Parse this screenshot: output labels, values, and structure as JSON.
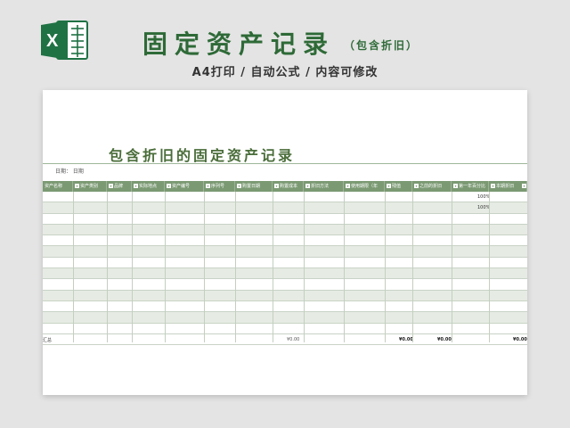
{
  "header": {
    "title": "固定资产记录",
    "subtitle": "（包含折旧）",
    "tagline": "A4打印 / 自动公式 / 内容可修改",
    "logo_letter": "X"
  },
  "sheet": {
    "title": "包含折旧的固定资产记录",
    "date_label": "日期： 日期"
  },
  "table": {
    "columns": [
      {
        "label": "资产名称",
        "dd": true
      },
      {
        "label": "资产类别",
        "dd": true
      },
      {
        "label": "品牌",
        "dd": true
      },
      {
        "label": "实际地点",
        "dd": true
      },
      {
        "label": "资产编号",
        "dd": true
      },
      {
        "label": "序列号",
        "dd": true
      },
      {
        "label": "购置日期",
        "dd": true
      },
      {
        "label": "购置成本",
        "dd": true
      },
      {
        "label": "折旧方法",
        "dd": true
      },
      {
        "label": "使用期限（年",
        "dd": true
      },
      {
        "label": "残值",
        "dd": true
      },
      {
        "label": "之前的折旧",
        "dd": true
      },
      {
        "label": "第一年百分比",
        "dd": true
      },
      {
        "label": "本期折旧",
        "dd": true
      }
    ],
    "percent_values": [
      "100%",
      "100%"
    ],
    "total": {
      "label": "汇总",
      "cost": "¥0.00",
      "salvage": "¥0.00",
      "previous": "¥0.00",
      "current": "¥0.00"
    }
  },
  "colors": {
    "brand_green": "#2e6a37",
    "header_fill": "#7b9a73",
    "band_fill": "#e6ebe3"
  }
}
